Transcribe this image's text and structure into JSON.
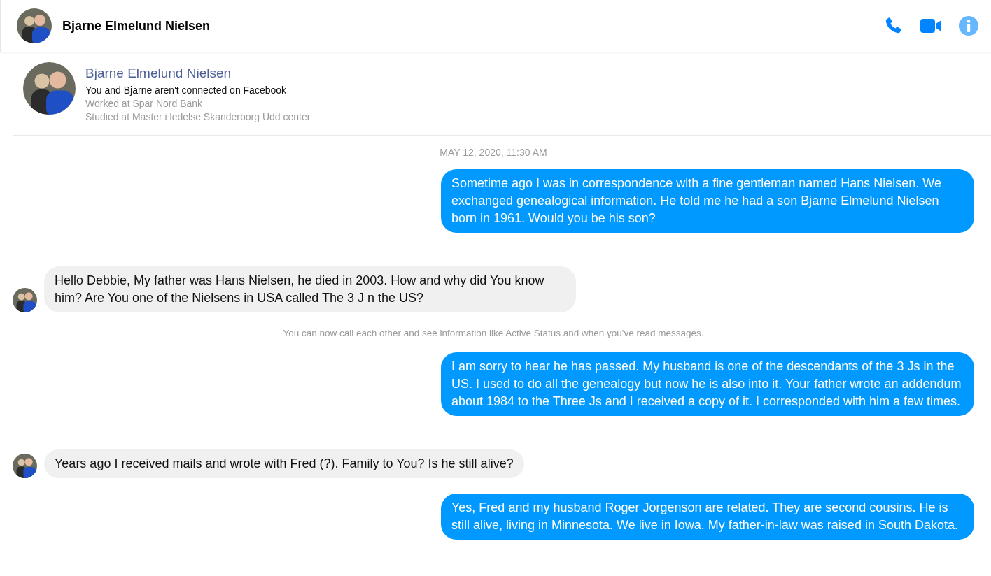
{
  "header": {
    "name": "Bjarne Elmelund Nielsen"
  },
  "profile": {
    "name": "Bjarne Elmelund Nielsen",
    "connection": "You and Bjarne aren't connected on Facebook",
    "details": [
      "Worked at Spar Nord Bank",
      "Studied at Master i ledelse Skanderborg Udd center"
    ]
  },
  "messages": [
    {
      "kind": "timestamp",
      "text": "MAY 12, 2020, 11:30 AM"
    },
    {
      "kind": "sent",
      "text": "Sometime ago I was in correspondence with a fine gentleman named Hans Nielsen. We exchanged genealogical information. He told me he had a son Bjarne Elmelund Nielsen born in 1961. Would you be his son?"
    },
    {
      "kind": "received",
      "text": "Hello Debbie, My father was Hans Nielsen, he died in 2003. How and why did You know him? Are You one of the Nielsens in USA called The 3 J n the US?"
    },
    {
      "kind": "notice",
      "text": "You can now call each other and see information like Active Status and when you've read messages."
    },
    {
      "kind": "sent",
      "text": "I am sorry to hear he has passed. My husband is one of the descendants of the 3 Js in the US. I used to do all the genealogy but now he is also into it. Your father wrote an addendum about 1984 to the Three Js and I received a copy of it. I corresponded with him a few times."
    },
    {
      "kind": "received",
      "text": "Years ago I received mails and wrote with Fred (?). Family to You? Is he still alive?"
    },
    {
      "kind": "sent",
      "text": "Yes, Fred and my husband Roger Jorgenson are related. They are second cousins. He is still alive, living in Minnesota. We live in Iowa. My father-in-law was raised in South Dakota."
    }
  ]
}
